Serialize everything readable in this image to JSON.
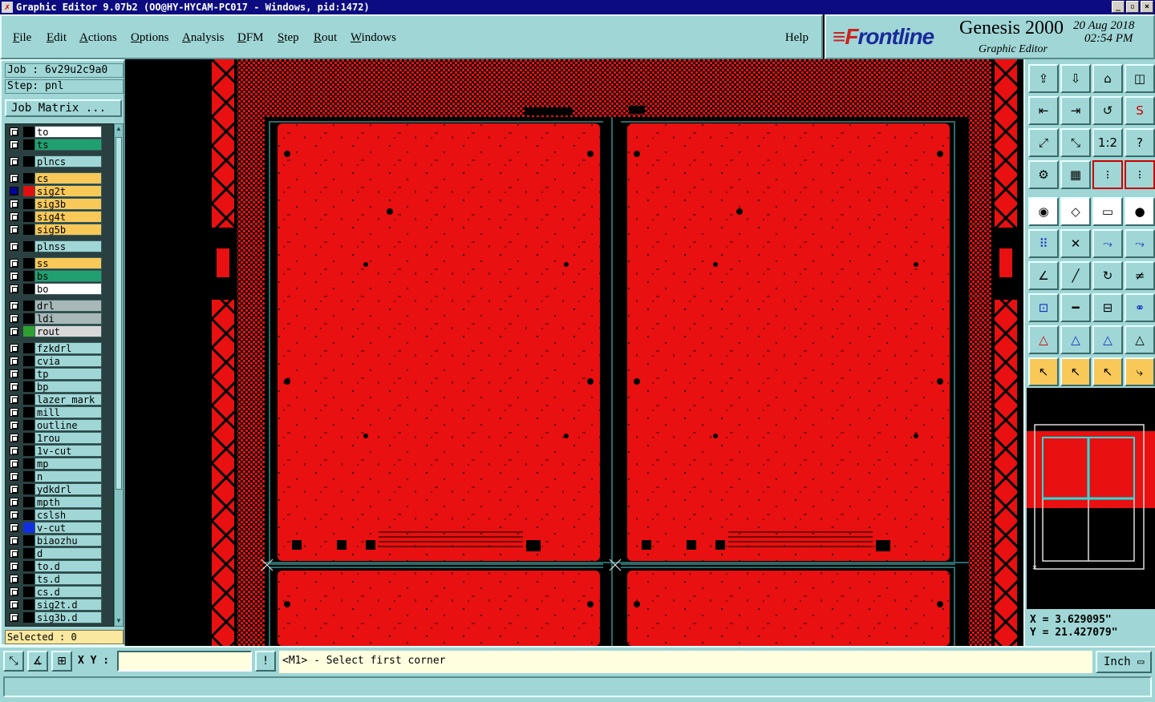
{
  "window": {
    "title": "Graphic Editor 9.07b2  (OO@HY-HYCAM-PC017 - Windows, pid:1472)",
    "minimize": "_",
    "maximize": "▫",
    "close": "×"
  },
  "menu": {
    "items": [
      "File",
      "Edit",
      "Actions",
      "Options",
      "Analysis",
      "DFM",
      "Step",
      "Rout",
      "Windows"
    ],
    "help": "Help"
  },
  "brand": {
    "logo_mark": "≡F",
    "logo_text": "rontline",
    "product": "Genesis 2000",
    "subtitle": "Graphic Editor",
    "date": "20 Aug 2018",
    "time": "02:54 PM"
  },
  "job": {
    "job_label": "Job : 6v29u2c9a0",
    "step_label": "Step: pnl",
    "matrix_button": "Job Matrix ..."
  },
  "layers": [
    {
      "name": "to",
      "color": "#ffffff",
      "swatch": "#000000"
    },
    {
      "name": "ts",
      "color": "#20a070",
      "swatch": "#000000"
    },
    {
      "name": "plncs",
      "color": "#a0d6d6",
      "swatch": "#000000",
      "gap": true
    },
    {
      "name": "cs",
      "color": "#f8c858",
      "swatch": "#000000",
      "gap": true
    },
    {
      "name": "sig2t",
      "color": "#f8c858",
      "swatch": "#e01010",
      "selected": true
    },
    {
      "name": "sig3b",
      "color": "#f8c858",
      "swatch": "#000000"
    },
    {
      "name": "sig4t",
      "color": "#f8c858",
      "swatch": "#000000"
    },
    {
      "name": "sig5b",
      "color": "#f8c858",
      "swatch": "#000000"
    },
    {
      "name": "plnss",
      "color": "#a0d6d6",
      "swatch": "#000000",
      "gap": true
    },
    {
      "name": "ss",
      "color": "#f8c858",
      "swatch": "#000000",
      "gap": true
    },
    {
      "name": "bs",
      "color": "#20a070",
      "swatch": "#000000"
    },
    {
      "name": "bo",
      "color": "#ffffff",
      "swatch": "#000000"
    },
    {
      "name": "drl",
      "color": "#a8b8b8",
      "swatch": "#000000",
      "gap": true
    },
    {
      "name": "ldi",
      "color": "#a8b8b8",
      "swatch": "#000000"
    },
    {
      "name": "rout",
      "color": "#d8d8d8",
      "swatch": "#30a030"
    },
    {
      "name": "fzkdrl",
      "color": "#a0d6d6",
      "swatch": "#000000",
      "gap": true
    },
    {
      "name": "cvia",
      "color": "#a0d6d6",
      "swatch": "#000000"
    },
    {
      "name": "tp",
      "color": "#a0d6d6",
      "swatch": "#000000"
    },
    {
      "name": "bp",
      "color": "#a0d6d6",
      "swatch": "#000000"
    },
    {
      "name": "lazer_mark",
      "color": "#a0d6d6",
      "swatch": "#000000"
    },
    {
      "name": "mill",
      "color": "#a0d6d6",
      "swatch": "#000000"
    },
    {
      "name": "outline",
      "color": "#a0d6d6",
      "swatch": "#000000"
    },
    {
      "name": "1rou",
      "color": "#a0d6d6",
      "swatch": "#000000"
    },
    {
      "name": "1v-cut",
      "color": "#a0d6d6",
      "swatch": "#000000"
    },
    {
      "name": "mp",
      "color": "#a0d6d6",
      "swatch": "#000000"
    },
    {
      "name": "n",
      "color": "#a0d6d6",
      "swatch": "#000000"
    },
    {
      "name": "ydkdrl",
      "color": "#a0d6d6",
      "swatch": "#000000"
    },
    {
      "name": "mpth",
      "color": "#a0d6d6",
      "swatch": "#000000"
    },
    {
      "name": "cslsh",
      "color": "#a0d6d6",
      "swatch": "#000000"
    },
    {
      "name": "v-cut",
      "color": "#a0d6d6",
      "swatch": "#1030e0"
    },
    {
      "name": "biaozhu",
      "color": "#a0d6d6",
      "swatch": "#000000"
    },
    {
      "name": "d",
      "color": "#a0d6d6",
      "swatch": "#000000"
    },
    {
      "name": "to.d",
      "color": "#a0d6d6",
      "swatch": "#000000"
    },
    {
      "name": "ts.d",
      "color": "#a0d6d6",
      "swatch": "#000000"
    },
    {
      "name": "cs.d",
      "color": "#a0d6d6",
      "swatch": "#000000"
    },
    {
      "name": "sig2t.d",
      "color": "#a0d6d6",
      "swatch": "#000000"
    },
    {
      "name": "sig3b.d",
      "color": "#a0d6d6",
      "swatch": "#000000"
    }
  ],
  "selected_count": "Selected : 0",
  "toolbox": {
    "icons": [
      "save-up-icon",
      "save-down-icon",
      "home-icon",
      "split-view-icon",
      "arrow-left-box-icon",
      "arrow-right-box-icon",
      "undo-icon",
      "redo-s-icon",
      "zoom-fit-icon",
      "zoom-center-icon",
      "ratio-icon",
      "help-icon",
      "tools-icon",
      "grid-icon",
      "layer-toggle-a-icon",
      "layer-toggle-b-icon",
      "pad-icon",
      "edit-shape-icon",
      "ruler-icon",
      "snap-circle-icon",
      "nodes-icon",
      "cross-icon",
      "line-node-icon",
      "line-node-b-icon",
      "angle-icon",
      "diagonal-icon",
      "arc-icon",
      "mirror-icon",
      "move-node-icon",
      "minus-icon",
      "dimension-icon",
      "group-icon",
      "triangle-red-icon",
      "triangle-blue-icon",
      "triangle-blue-b-icon",
      "triangle-crossed-icon",
      "pointer-icon",
      "pointer-select-icon",
      "pointer-edit-icon",
      "pointer-path-icon"
    ],
    "glyphs": [
      "⇪",
      "⇩",
      "⌂",
      "◫",
      "⇤",
      "⇥",
      "↺",
      "S",
      "⤢",
      "⤡",
      "1:2",
      "?",
      "⚙",
      "▦",
      "⁝",
      "⁝",
      "◉",
      "◇",
      "▭",
      "●",
      "⠿",
      "✕",
      "⤳",
      "⤳",
      "∠",
      "╱",
      "↻",
      "≠",
      "⊡",
      "━",
      "⊟",
      "⚭",
      "△",
      "△",
      "△",
      "△",
      "↖",
      "↖",
      "↖",
      "⤷"
    ]
  },
  "coords": {
    "x": "X = 3.629095\"",
    "y": "Y = 21.427079\""
  },
  "command": {
    "xy_label": "X Y :",
    "xy_value": "",
    "info_icon": "!",
    "prompt": "<M1> - Select first corner",
    "unit": "Inch"
  },
  "status": "",
  "colors": {
    "panel": "#a0d6d6",
    "copper": "#e81010",
    "dark": "#000000",
    "board_line": "#2a6a6a",
    "cyan": "#20e0e0"
  }
}
